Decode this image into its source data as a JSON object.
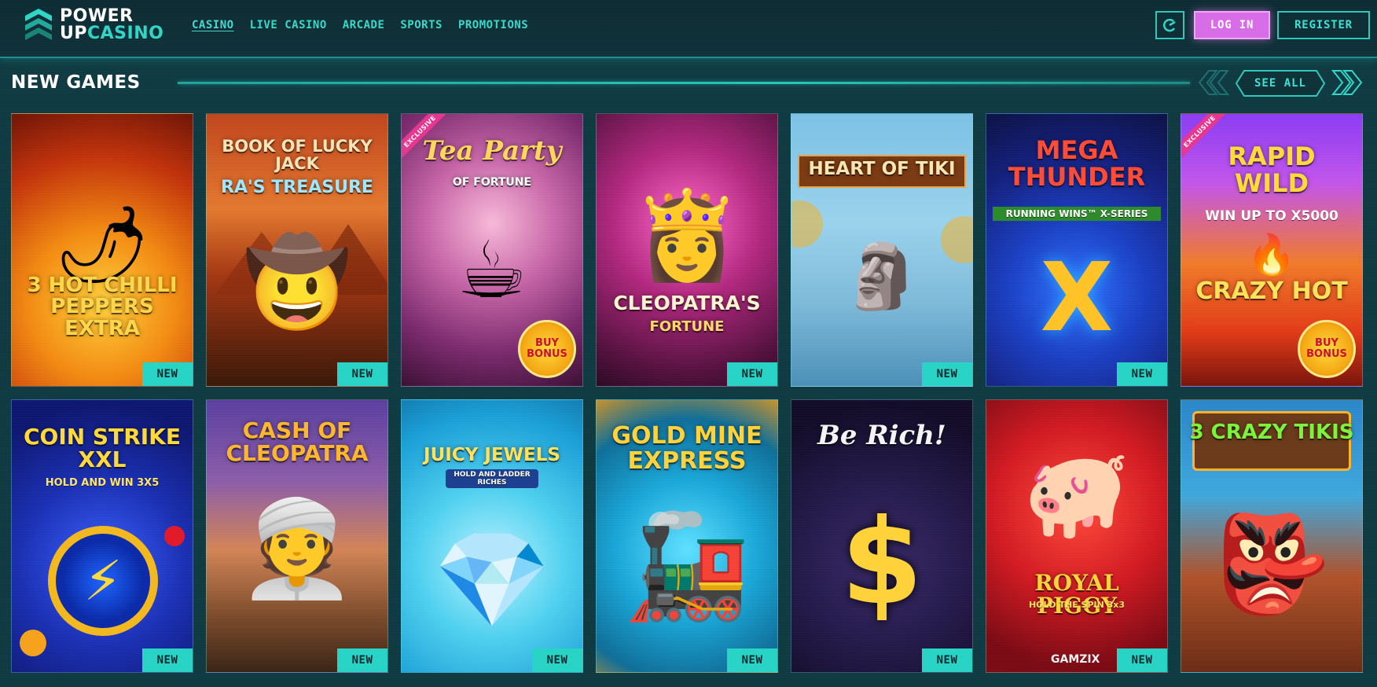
{
  "brand": {
    "line1": "POWER",
    "line2a": "UP",
    "line2b": "CASINO"
  },
  "nav": [
    {
      "label": "CASINO",
      "active": true
    },
    {
      "label": "LIVE CASINO"
    },
    {
      "label": "ARCADE"
    },
    {
      "label": "SPORTS"
    },
    {
      "label": "PROMOTIONS"
    }
  ],
  "header_actions": {
    "login": "LOG IN",
    "register": "REGISTER",
    "c_icon": "c-logo-icon"
  },
  "section": {
    "title": "NEW GAMES",
    "see_all": "SEE ALL"
  },
  "badge_label": "NEW",
  "games": [
    {
      "title": "3 HOT CHILLI PEPPERS EXTRA",
      "badge": "NEW",
      "icon": "chili-pepper-icon"
    },
    {
      "title": "BOOK OF LUCKY JACK",
      "sub": "RA'S TREASURE",
      "badge": "NEW",
      "icon": "adventurer-icon"
    },
    {
      "title": "Tea Party",
      "sub": "OF FORTUNE",
      "ribbon": "EXCLUSIVE",
      "buy": "BUY BONUS",
      "icon": "teacup-icon"
    },
    {
      "title": "CLEOPATRA'S",
      "sub": "FORTUNE",
      "badge": "NEW",
      "icon": "queen-icon"
    },
    {
      "title": "HEART OF TIKI",
      "badge": "NEW",
      "icon": "tiki-icon"
    },
    {
      "title": "MEGA THUNDER",
      "sub": "RUNNING WINS™ X-SERIES",
      "badge": "NEW",
      "icon": "x-icon"
    },
    {
      "title": "RAPID WILD",
      "sub": "WIN UP TO X5000",
      "ribbon": "EXCLUSIVE",
      "buy": "BUY BONUS",
      "extra": "CRAZY HOT",
      "icon": "flame-icon"
    },
    {
      "title": "COIN STRIKE XXL",
      "sub": "HOLD AND WIN 3X5",
      "badge": "NEW",
      "icon": "lightning-coin-icon"
    },
    {
      "title": "CASH OF CLEOPATRA",
      "badge": "NEW",
      "icon": "pharaoh-icon"
    },
    {
      "title": "JUICY JEWELS",
      "sub": "HOLD AND LADDER RICHES",
      "badge": "NEW",
      "icon": "diamond-icon"
    },
    {
      "title": "GOLD MINE EXPRESS",
      "badge": "NEW",
      "icon": "train-icon"
    },
    {
      "title": "Be Rich!",
      "badge": "NEW",
      "icon": "dollar-icon"
    },
    {
      "title": "ROYAL PIGGY",
      "sub": "HOLD THE SPIN 3x3",
      "provider": "GAMZIX",
      "badge": "NEW",
      "icon": "piggy-bank-icon"
    },
    {
      "title": "3 CRAZY TIKIS",
      "icon": "tiki-mask-icon"
    }
  ],
  "theme": {
    "accent": "#2fd6c6",
    "login_bg": "#d86ce6",
    "bg": "#0f3a42"
  }
}
